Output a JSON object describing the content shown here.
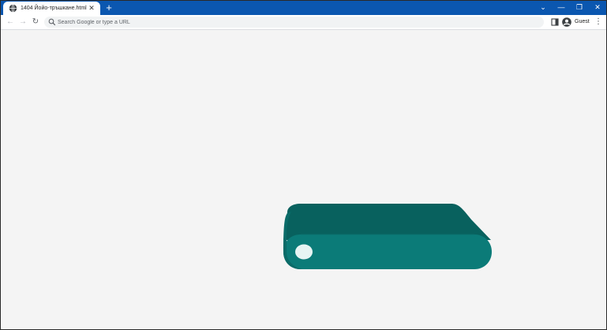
{
  "browser": {
    "tab": {
      "title": "1404 Йойо-тръшкане.html",
      "close_glyph": "✕"
    },
    "new_tab_glyph": "+",
    "window_controls": {
      "tab_search": "⌄",
      "minimize": "—",
      "restore": "❐",
      "close": "✕"
    },
    "toolbar": {
      "back_glyph": "←",
      "forward_glyph": "→",
      "reload_glyph": "↻",
      "omnibox_placeholder": "Search Google or type a URL",
      "profile_label": "Guest",
      "menu_glyph": "⋮"
    }
  },
  "scene": {
    "object": "3d-rounded-slab-with-hole",
    "colors": {
      "top_face": "#08615e",
      "front_face": "#0b7b78",
      "left_end": "#0a6b68",
      "hole": "#e6f4f3",
      "background": "#f4f4f4"
    }
  }
}
